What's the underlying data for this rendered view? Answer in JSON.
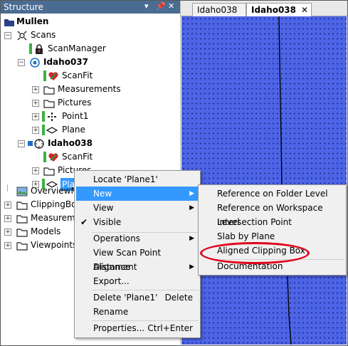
{
  "panel": {
    "title": "Structure",
    "controls": [
      "▾",
      "✕",
      "✕"
    ]
  },
  "tree": [
    {
      "label": "Mullen",
      "bold": true
    },
    {
      "label": "Scans"
    },
    {
      "label": "ScanManager"
    },
    {
      "label": "Idaho037",
      "bold": true
    },
    {
      "label": "ScanFit"
    },
    {
      "label": "Measurements"
    },
    {
      "label": "Pictures"
    },
    {
      "label": "Point1"
    },
    {
      "label": "Plane"
    },
    {
      "label": "Idaho038",
      "bold": true
    },
    {
      "label": "ScanFit"
    },
    {
      "label": "Pictures"
    },
    {
      "label": "Pla"
    },
    {
      "label": "OverviewM"
    },
    {
      "label": "ClippingBox"
    },
    {
      "label": "Measureme"
    },
    {
      "label": "Models"
    },
    {
      "label": "Viewpoints"
    }
  ],
  "tabs": [
    {
      "label": "Idaho038"
    },
    {
      "label": "Idaho038",
      "close": "✕"
    }
  ],
  "context_menu": [
    {
      "label": "Locate 'Plane1'"
    },
    {
      "label": "New",
      "submenu": true,
      "highlighted": true
    },
    {
      "label": "View",
      "submenu": true
    },
    {
      "label": "Visible",
      "checked": true
    },
    {
      "label": "Operations",
      "submenu": true
    },
    {
      "label": "View Scan Point Distance"
    },
    {
      "label": "Alignment",
      "submenu": true
    },
    {
      "label": "Export..."
    },
    {
      "label": "Delete 'Plane1'",
      "shortcut": "Delete"
    },
    {
      "label": "Rename"
    },
    {
      "label": "Properties...",
      "shortcut": "Ctrl+Enter"
    }
  ],
  "submenu": [
    {
      "label": "Reference on Folder Level"
    },
    {
      "label": "Reference on Workspace Level"
    },
    {
      "label": "Intersection Point"
    },
    {
      "label": "Slab by Plane"
    },
    {
      "label": "Aligned Clipping Box",
      "annotated": true
    },
    {
      "label": "Documentation"
    }
  ],
  "colors": {
    "panel_header": "#4a6c92",
    "highlight": "#3399ff",
    "view_bg": "#4d64e6",
    "annotation": "#e0001b"
  }
}
